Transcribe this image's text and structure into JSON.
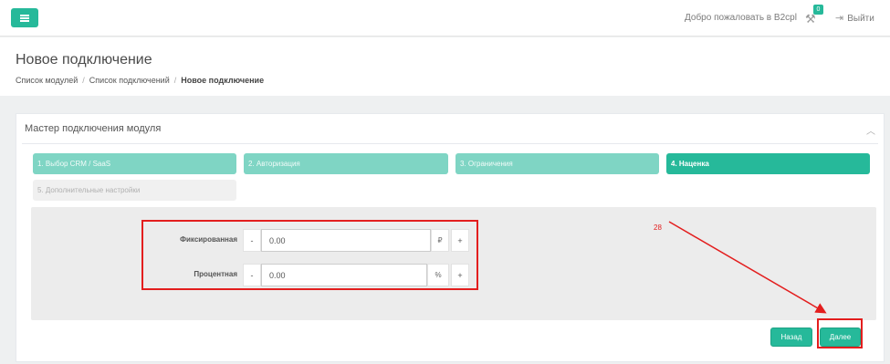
{
  "topbar": {
    "welcome": "Добро пожаловать в B2cpl",
    "notifications_count": "0",
    "logout": "Выйти"
  },
  "page": {
    "title": "Новое подключение",
    "breadcrumb": [
      "Список модулей",
      "Список подключений",
      "Новое подключение"
    ]
  },
  "wizard": {
    "title": "Мастер подключения модуля",
    "steps": [
      {
        "label": "1. Выбор CRM / SaaS",
        "state": "done"
      },
      {
        "label": "2. Авторизация",
        "state": "done"
      },
      {
        "label": "3. Ограничения",
        "state": "done"
      },
      {
        "label": "4. Наценка",
        "state": "active"
      },
      {
        "label": "5. Дополнительные настройки",
        "state": "disabled"
      }
    ],
    "fields": [
      {
        "label": "Фиксированная",
        "minus": "-",
        "value": "0.00",
        "unit": "₽",
        "plus": "+"
      },
      {
        "label": "Процентная",
        "minus": "-",
        "value": "0.00",
        "unit": "%",
        "plus": "+"
      }
    ],
    "back_label": "Назад",
    "next_label": "Далее"
  },
  "annotation": {
    "number": "28",
    "color": "#e31e1e"
  },
  "colors": {
    "accent": "#26b99a",
    "step_done": "#7fd5c4"
  }
}
